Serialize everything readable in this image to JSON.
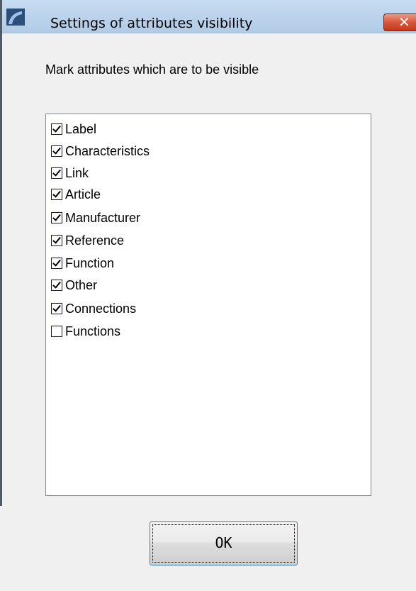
{
  "window": {
    "title": "Settings of attributes visibility",
    "close_label": "✕"
  },
  "instruction": "Mark attributes which are to be visible",
  "attributes": [
    {
      "label": "Label",
      "checked": true
    },
    {
      "label": "Characteristics",
      "checked": true
    },
    {
      "label": "Link",
      "checked": true
    },
    {
      "label": "Article",
      "checked": true
    },
    {
      "label": "Manufacturer",
      "checked": true
    },
    {
      "label": "Reference",
      "checked": true
    },
    {
      "label": "Function",
      "checked": true
    },
    {
      "label": "Other",
      "checked": true
    },
    {
      "label": "Connections",
      "checked": true
    },
    {
      "label": "Functions",
      "checked": false
    }
  ],
  "buttons": {
    "ok_label": "OK"
  },
  "colors": {
    "titlebar": "#b9d1ea",
    "close_button": "#d7573a",
    "dialog_background": "#f0f0f0",
    "button_focus_border": "#3c7fb1"
  }
}
